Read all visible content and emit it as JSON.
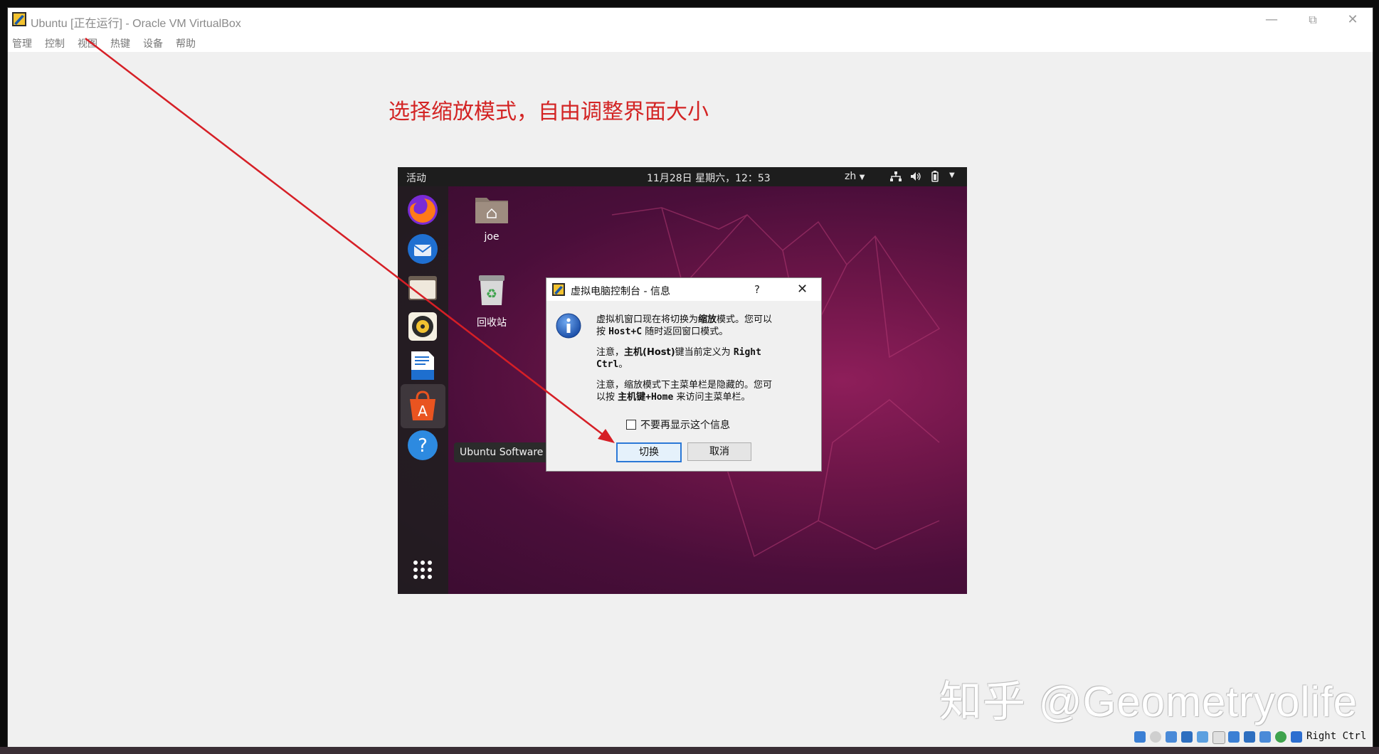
{
  "window": {
    "title": "Ubuntu [正在运行] - Oracle VM VirtualBox",
    "minimize_icon": "minimize-icon",
    "maximize_icon": "restore-icon",
    "close_icon": "close-icon"
  },
  "menubar": {
    "items": [
      "管理",
      "控制",
      "视图",
      "热键",
      "设备",
      "帮助"
    ]
  },
  "annotation": {
    "text": "选择缩放模式，自由调整界面大小",
    "color": "#d32424"
  },
  "vm": {
    "topbar": {
      "activities": "活动",
      "clock": "11月28日 星期六，12：53",
      "input_method": "zh"
    },
    "dock": {
      "items": [
        "firefox-icon",
        "thunderbird-icon",
        "files-icon",
        "rhythmbox-icon",
        "libreoffice-writer-icon",
        "ubuntu-software-icon",
        "help-icon",
        "app-grid-icon"
      ]
    },
    "desktop": {
      "home_label": "joe",
      "trash_label": "回收站"
    },
    "tooltip": "Ubuntu Software"
  },
  "dialog": {
    "title": "虚拟电脑控制台 - 信息",
    "help_label": "?",
    "para1_a": "虚拟机窗口现在将切换为",
    "para1_b": "缩放",
    "para1_c": "模式。您可以",
    "para1_d": "按",
    "para1_e": "Host+C",
    "para1_f": "随时返回窗口模式。",
    "para2_a": "注意，",
    "para2_b": "主机(Host)",
    "para2_c": "键当前定义为",
    "para2_d": "Right",
    "para2_e": "Ctrl",
    "para2_f": "。",
    "para3_a": "注意，缩放模式下主菜单栏是隐藏的。您可",
    "para3_b": "以按",
    "para3_c": "主机键+Home",
    "para3_d": "来访问主菜单栏。",
    "checkbox_label": "不要再显示这个信息",
    "checkbox_checked": false,
    "ok_button": "切换",
    "cancel_button": "取消"
  },
  "statusbar": {
    "host_key": "Right Ctrl"
  },
  "watermark": "知乎 @Geometryolife"
}
